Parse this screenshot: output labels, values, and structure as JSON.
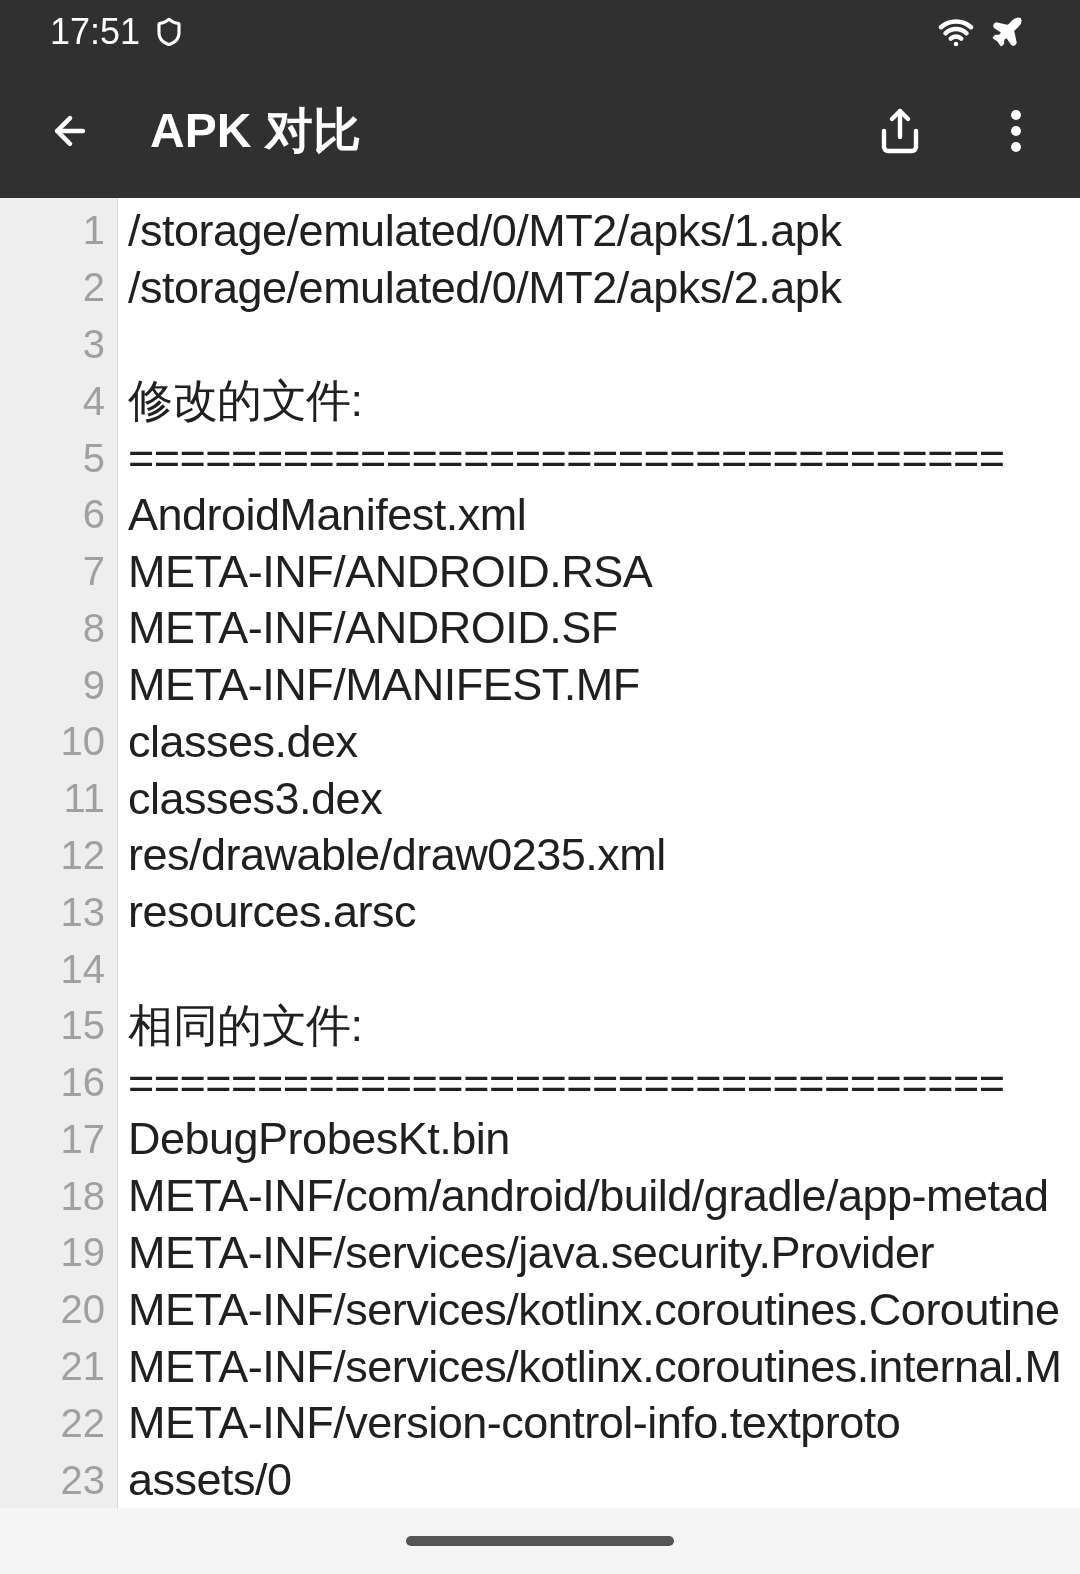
{
  "status_bar": {
    "time": "17:51"
  },
  "toolbar": {
    "title": "APK 对比"
  },
  "lines": [
    {
      "number": "1",
      "text": "/storage/emulated/0/MT2/apks/1.apk"
    },
    {
      "number": "2",
      "text": "/storage/emulated/0/MT2/apks/2.apk"
    },
    {
      "number": "3"
    },
    {
      "number": "4",
      "text": "修改的文件:"
    },
    {
      "number": "5",
      "text": "=================================="
    },
    {
      "number": "6",
      "text": "AndroidManifest.xml"
    },
    {
      "number": "7",
      "text": "META-INF/ANDROID.RSA"
    },
    {
      "number": "8",
      "text": "META-INF/ANDROID.SF"
    },
    {
      "number": "9",
      "text": "META-INF/MANIFEST.MF"
    },
    {
      "number": "10",
      "text": "classes.dex"
    },
    {
      "number": "11",
      "text": "classes3.dex"
    },
    {
      "number": "12",
      "text": "res/drawable/draw0235.xml"
    },
    {
      "number": "13",
      "text": "resources.arsc"
    },
    {
      "number": "14"
    },
    {
      "number": "15",
      "text": "相同的文件:"
    },
    {
      "number": "16",
      "text": "=================================="
    },
    {
      "number": "17",
      "text": "DebugProbesKt.bin"
    },
    {
      "number": "18",
      "text": "META-INF/com/android/build/gradle/app-metad"
    },
    {
      "number": "19",
      "text": "META-INF/services/java.security.Provider"
    },
    {
      "number": "20",
      "text": "META-INF/services/kotlinx.coroutines.Coroutine"
    },
    {
      "number": "21",
      "text": "META-INF/services/kotlinx.coroutines.internal.M"
    },
    {
      "number": "22",
      "text": "META-INF/version-control-info.textproto"
    },
    {
      "number": "23",
      "text": "assets/0"
    }
  ]
}
